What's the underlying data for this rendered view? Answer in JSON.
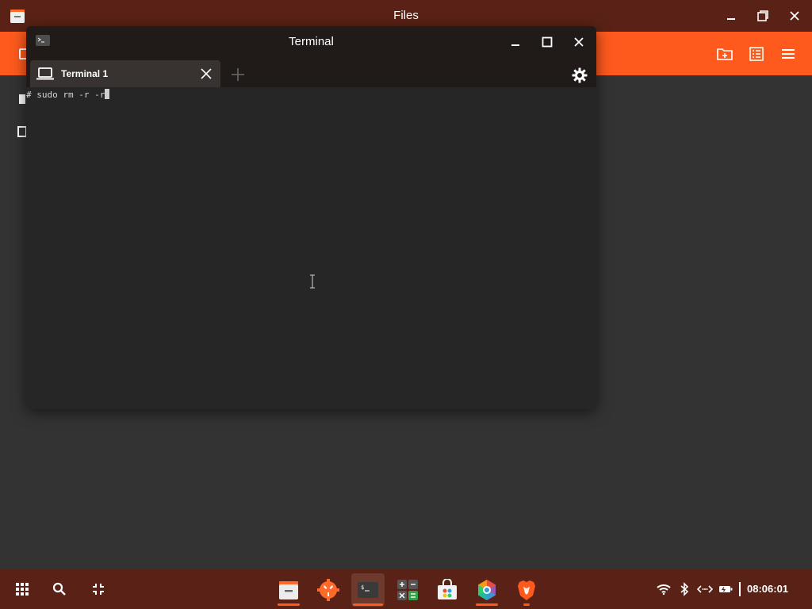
{
  "files": {
    "title": "Files",
    "app_icon": "files-folder-icon",
    "toolbar": {
      "new_folder_icon": "folder-plus-icon",
      "view_icon": "list-view-icon",
      "menu_icon": "hamburger-menu-icon"
    }
  },
  "terminal": {
    "title": "Terminal",
    "tab": {
      "label": "Terminal 1"
    },
    "prompt": "# ",
    "command": "sudo rm -r -r"
  },
  "taskbar": {
    "clock": "08:06:01",
    "apps": [
      {
        "name": "files",
        "active": false,
        "running": true
      },
      {
        "name": "settings",
        "active": false,
        "running": false
      },
      {
        "name": "terminal",
        "active": true,
        "running": true
      },
      {
        "name": "calculator",
        "active": false,
        "running": false
      },
      {
        "name": "store",
        "active": false,
        "running": false
      },
      {
        "name": "browser",
        "active": false,
        "running": true
      },
      {
        "name": "brave",
        "active": false,
        "running": true
      }
    ],
    "tray": [
      "wifi-icon",
      "bluetooth-icon",
      "network-icon",
      "battery-icon"
    ]
  },
  "colors": {
    "accent": "#fe5a1d",
    "titlebar": "#5a2216",
    "terminal_bg": "#262626",
    "desktop_bg": "#333333"
  }
}
